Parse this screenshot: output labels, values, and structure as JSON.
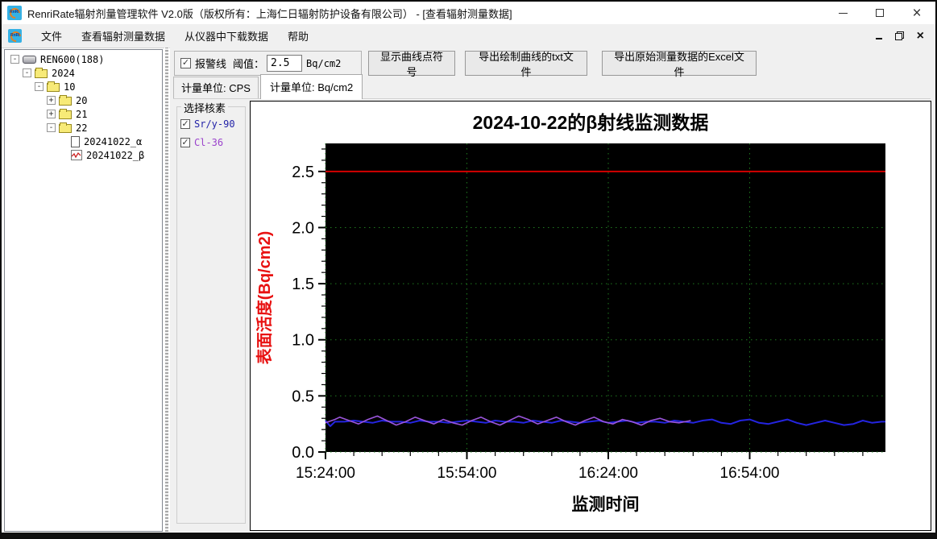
{
  "window": {
    "title": "RenriRate辐射剂量管理软件 V2.0版（版权所有：上海仁日辐射防护设备有限公司） - [查看辐射测量数据]"
  },
  "menu": {
    "items": [
      "文件",
      "查看辐射测量数据",
      "从仪器中下载数据",
      "帮助"
    ]
  },
  "tree": {
    "nodes": [
      {
        "label": "REN600(188)",
        "level": 0,
        "expander": "minus",
        "icon": "device"
      },
      {
        "label": "2024",
        "level": 1,
        "expander": "minus",
        "icon": "folder"
      },
      {
        "label": "10",
        "level": 2,
        "expander": "minus",
        "icon": "folder"
      },
      {
        "label": "20",
        "level": 3,
        "expander": "plus",
        "icon": "folder"
      },
      {
        "label": "21",
        "level": 3,
        "expander": "plus",
        "icon": "folder"
      },
      {
        "label": "22",
        "level": 3,
        "expander": "minus",
        "icon": "folder"
      },
      {
        "label": "20241022_α",
        "level": 4,
        "expander": "none",
        "icon": "document"
      },
      {
        "label": "20241022_β",
        "level": 4,
        "expander": "none",
        "icon": "chart"
      }
    ]
  },
  "toolbar": {
    "alarm_checkbox_label": "报警线",
    "alarm_checked": true,
    "threshold_label": "阈值：",
    "threshold_value": "2.5",
    "threshold_unit": "Bq/cm2",
    "show_points_button": "显示曲线点符号",
    "export_txt_button": "导出绘制曲线的txt文件",
    "export_excel_button": "导出原始测量数据的Excel文件"
  },
  "tabs": [
    {
      "label": "计量单位: CPS",
      "active": false
    },
    {
      "label": "计量单位: Bq/cm2",
      "active": true
    }
  ],
  "nuclide_panel": {
    "title": "选择核素",
    "items": [
      {
        "label": "Sr/y-90",
        "checked": true,
        "color": "#2323a8"
      },
      {
        "label": "Cl-36",
        "checked": true,
        "color": "#9b44cc"
      }
    ]
  },
  "chart_data": {
    "type": "line",
    "title": "2024-10-22的β射线监测数据",
    "xlabel": "监测时间",
    "ylabel": "表面活度(Bq/cm2)",
    "ylabel_color": "#e81111",
    "plot_bg": "#000000",
    "grid_color": "#1f7a1f",
    "grid": true,
    "ylim": [
      0,
      2.75
    ],
    "y_ticks": [
      0.0,
      0.5,
      1.0,
      1.5,
      2.0,
      2.5
    ],
    "y_minor_step": 0.1,
    "x_range_minutes": [
      0,
      118.8
    ],
    "x_tick_minutes": [
      0,
      30,
      60,
      90
    ],
    "x_tick_labels": [
      "15:24:00",
      "15:54:00",
      "16:24:00",
      "16:54:00"
    ],
    "x_minor_step": 6,
    "alarm_line": {
      "value": 2.5,
      "color": "#e00000"
    },
    "series": [
      {
        "name": "Sr/y-90",
        "color": "#2424e0",
        "points": [
          [
            0,
            0.28
          ],
          [
            1,
            0.23
          ],
          [
            2,
            0.27
          ],
          [
            4,
            0.27
          ],
          [
            6,
            0.28
          ],
          [
            8,
            0.27
          ],
          [
            10,
            0.26
          ],
          [
            12,
            0.28
          ],
          [
            14,
            0.27
          ],
          [
            16,
            0.27
          ],
          [
            18,
            0.26
          ],
          [
            20,
            0.28
          ],
          [
            22,
            0.27
          ],
          [
            24,
            0.27
          ],
          [
            26,
            0.26
          ],
          [
            28,
            0.27
          ],
          [
            30,
            0.28
          ],
          [
            32,
            0.27
          ],
          [
            34,
            0.26
          ],
          [
            36,
            0.28
          ],
          [
            38,
            0.27
          ],
          [
            40,
            0.27
          ],
          [
            42,
            0.26
          ],
          [
            44,
            0.28
          ],
          [
            46,
            0.27
          ],
          [
            48,
            0.26
          ],
          [
            50,
            0.28
          ],
          [
            52,
            0.27
          ],
          [
            54,
            0.26
          ],
          [
            56,
            0.27
          ],
          [
            58,
            0.28
          ],
          [
            60,
            0.26
          ],
          [
            62,
            0.27
          ],
          [
            64,
            0.28
          ],
          [
            66,
            0.26
          ],
          [
            68,
            0.27
          ],
          [
            70,
            0.27
          ],
          [
            72,
            0.26
          ],
          [
            74,
            0.28
          ],
          [
            76,
            0.27
          ],
          [
            78,
            0.26
          ],
          [
            80,
            0.28
          ],
          [
            82,
            0.29
          ],
          [
            84,
            0.26
          ],
          [
            86,
            0.25
          ],
          [
            88,
            0.28
          ],
          [
            90,
            0.29
          ],
          [
            92,
            0.26
          ],
          [
            94,
            0.25
          ],
          [
            96,
            0.27
          ],
          [
            98,
            0.29
          ],
          [
            100,
            0.26
          ],
          [
            102,
            0.24
          ],
          [
            104,
            0.26
          ],
          [
            106,
            0.28
          ],
          [
            108,
            0.26
          ],
          [
            110,
            0.24
          ],
          [
            112,
            0.25
          ],
          [
            114,
            0.28
          ],
          [
            116,
            0.26
          ],
          [
            118,
            0.27
          ],
          [
            118.8,
            0.27
          ]
        ]
      },
      {
        "name": "Cl-36",
        "color": "#9b55dd",
        "points": [
          [
            0,
            0.26
          ],
          [
            2,
            0.29
          ],
          [
            3,
            0.31
          ],
          [
            5,
            0.28
          ],
          [
            7,
            0.25
          ],
          [
            9,
            0.29
          ],
          [
            11,
            0.32
          ],
          [
            13,
            0.28
          ],
          [
            15,
            0.24
          ],
          [
            17,
            0.27
          ],
          [
            19,
            0.31
          ],
          [
            21,
            0.28
          ],
          [
            23,
            0.25
          ],
          [
            25,
            0.29
          ],
          [
            27,
            0.26
          ],
          [
            29,
            0.24
          ],
          [
            31,
            0.28
          ],
          [
            33,
            0.31
          ],
          [
            35,
            0.27
          ],
          [
            37,
            0.24
          ],
          [
            39,
            0.28
          ],
          [
            41,
            0.32
          ],
          [
            43,
            0.29
          ],
          [
            45,
            0.25
          ],
          [
            47,
            0.28
          ],
          [
            49,
            0.31
          ],
          [
            51,
            0.27
          ],
          [
            53,
            0.24
          ],
          [
            55,
            0.28
          ],
          [
            57,
            0.31
          ],
          [
            59,
            0.27
          ],
          [
            61,
            0.25
          ],
          [
            63,
            0.29
          ],
          [
            65,
            0.27
          ],
          [
            67,
            0.24
          ],
          [
            69,
            0.28
          ],
          [
            71,
            0.3
          ],
          [
            73,
            0.27
          ],
          [
            75,
            0.26
          ],
          [
            77.5,
            0.28
          ]
        ]
      }
    ]
  }
}
